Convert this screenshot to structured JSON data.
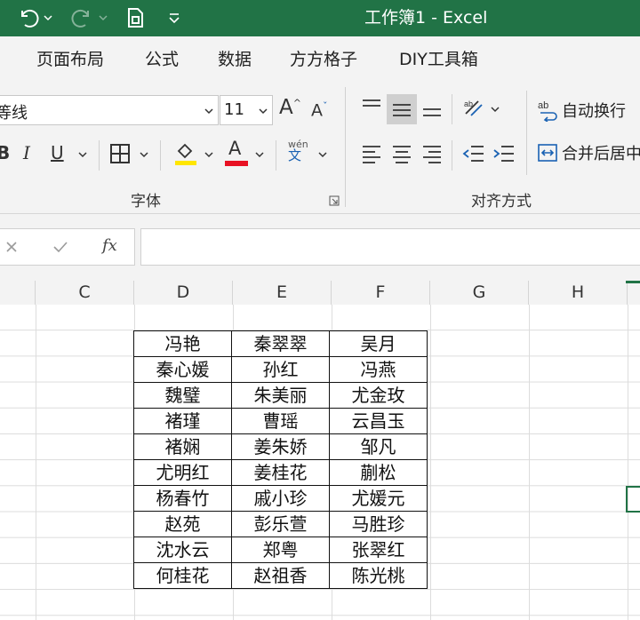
{
  "window": {
    "title": "工作簿1  -  Excel"
  },
  "quick_access": {
    "undo_icon": "undo-icon",
    "redo_icon": "redo-icon",
    "save_icon": "save-icon",
    "customize_icon": "customize-icon"
  },
  "ribbon": {
    "tabs": [
      {
        "label": "页面布局"
      },
      {
        "label": "公式"
      },
      {
        "label": "数据"
      },
      {
        "label": "方方格子"
      },
      {
        "label": "DIY工具箱"
      }
    ],
    "font": {
      "name": "等线",
      "size": "11",
      "group_label": "字体",
      "font_color": "#e81123",
      "fill_color": "#ffe600"
    },
    "alignment": {
      "wrap_text": "自动换行",
      "merge_center": "合并后居中",
      "group_label": "对齐方式"
    }
  },
  "formula_bar": {
    "fx": "fx",
    "value": ""
  },
  "sheet": {
    "columns": [
      "C",
      "D",
      "E",
      "F",
      "G",
      "H"
    ],
    "rows": [
      [
        "冯艳",
        "秦翠翠",
        "吴月"
      ],
      [
        "秦心媛",
        "孙红",
        "冯燕"
      ],
      [
        "魏璧",
        "朱美丽",
        "尤金玫"
      ],
      [
        "褚瑾",
        "曹瑶",
        "云昌玉"
      ],
      [
        "褚娴",
        "姜朱娇",
        "邹凡"
      ],
      [
        "尤明红",
        "姜桂花",
        "蒯松"
      ],
      [
        "杨春竹",
        "戚小珍",
        "尤媛元"
      ],
      [
        "赵苑",
        "彭乐萱",
        "马胜珍"
      ],
      [
        "沈水云",
        "郑粤",
        "张翠红"
      ],
      [
        "何桂花",
        "赵祖香",
        "陈光桃"
      ]
    ]
  }
}
